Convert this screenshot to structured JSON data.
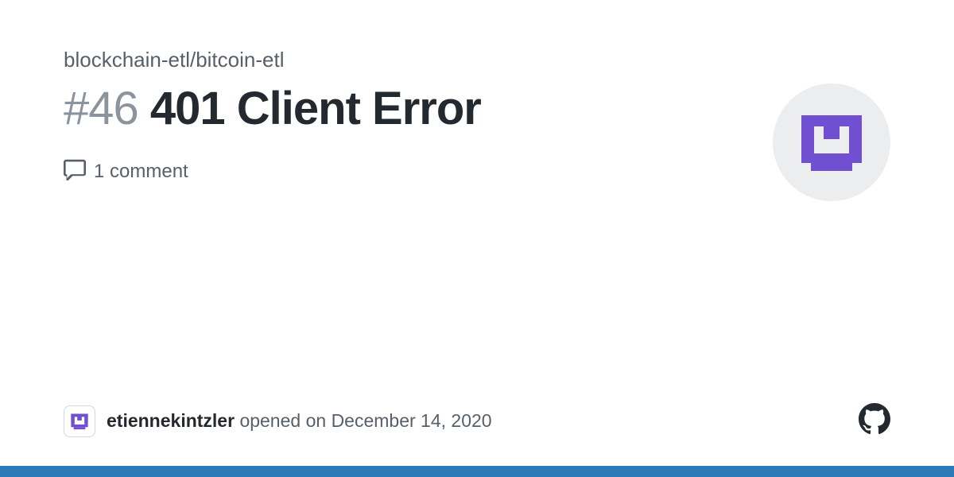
{
  "repo": "blockchain-etl/bitcoin-etl",
  "issue": {
    "number": "46",
    "title": "401 Client Error",
    "comments_text": "1 comment"
  },
  "author": {
    "name": "etiennekintzler",
    "action": "opened on",
    "date": "December 14, 2020"
  },
  "colors": {
    "accent": "#7050d0",
    "bottom_bar": "#2d7ab8"
  }
}
